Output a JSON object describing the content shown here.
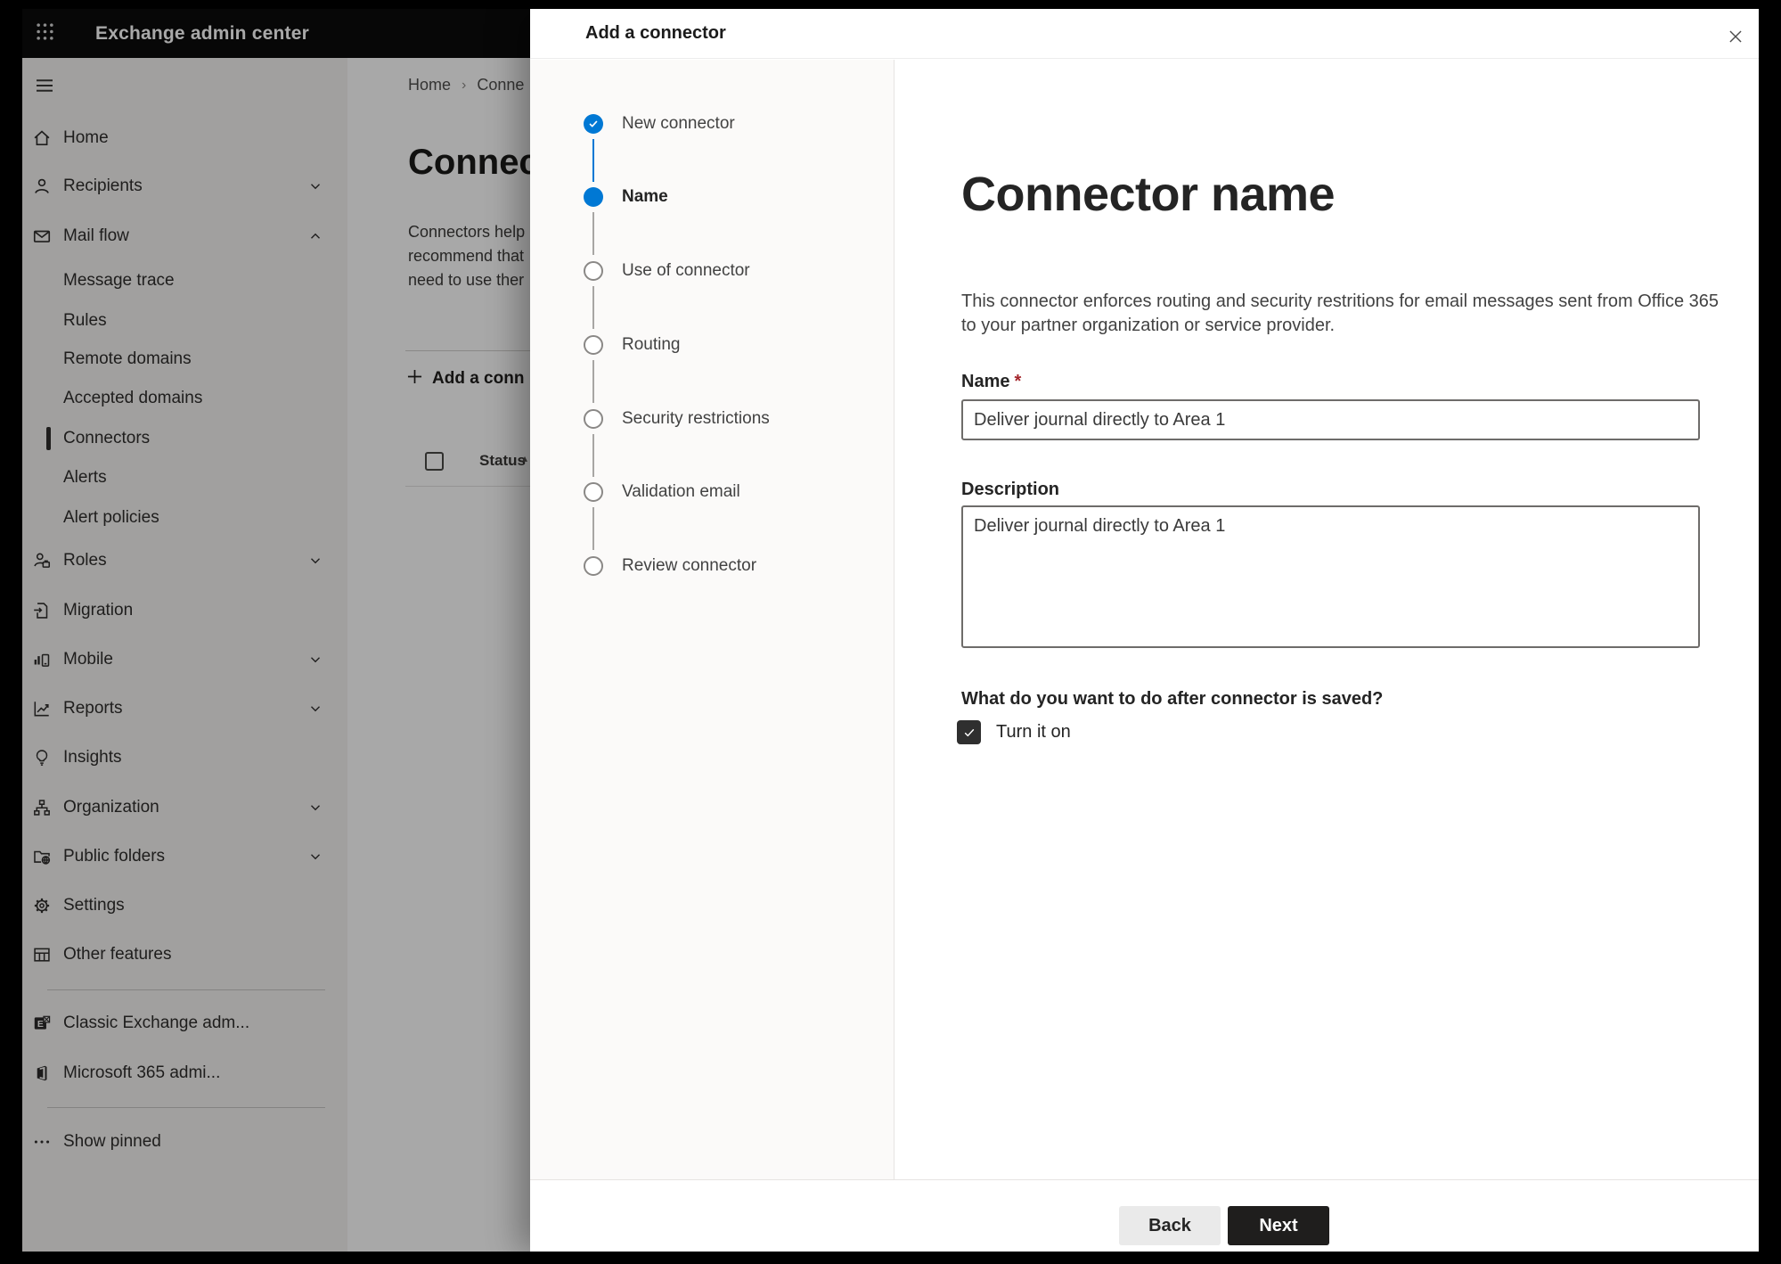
{
  "topbar": {
    "title": "Exchange admin center"
  },
  "sidebar": {
    "items": [
      {
        "label": "Home",
        "icon": "home-icon"
      },
      {
        "label": "Recipients",
        "icon": "person-icon",
        "chevron": "down"
      },
      {
        "label": "Mail flow",
        "icon": "mail-icon",
        "chevron": "up",
        "expanded": true
      },
      {
        "label": "Message trace",
        "indent": true
      },
      {
        "label": "Rules",
        "indent": true
      },
      {
        "label": "Remote domains",
        "indent": true
      },
      {
        "label": "Accepted domains",
        "indent": true
      },
      {
        "label": "Connectors",
        "indent": true,
        "selected": true
      },
      {
        "label": "Alerts",
        "indent": true
      },
      {
        "label": "Alert policies",
        "indent": true
      },
      {
        "label": "Roles",
        "icon": "roles-icon",
        "chevron": "down"
      },
      {
        "label": "Migration",
        "icon": "migration-icon"
      },
      {
        "label": "Mobile",
        "icon": "mobile-icon",
        "chevron": "down"
      },
      {
        "label": "Reports",
        "icon": "reports-icon",
        "chevron": "down"
      },
      {
        "label": "Insights",
        "icon": "lightbulb-icon"
      },
      {
        "label": "Organization",
        "icon": "org-chart-icon",
        "chevron": "down"
      },
      {
        "label": "Public folders",
        "icon": "folder-globe-icon",
        "chevron": "down"
      },
      {
        "label": "Settings",
        "icon": "gear-icon"
      },
      {
        "label": "Other features",
        "icon": "table-icon"
      },
      {
        "label": "Classic Exchange adm...",
        "icon": "exchange-logo-icon"
      },
      {
        "label": "Microsoft 365 admi...",
        "icon": "office-logo-icon"
      },
      {
        "label": "Show pinned",
        "icon": "ellipsis-icon"
      }
    ]
  },
  "page": {
    "breadcrumb": {
      "items": [
        "Home",
        "Conne"
      ],
      "separator": "›"
    },
    "title": "Connec",
    "intro_lines": [
      "Connectors help",
      "recommend that",
      "need to use ther"
    ],
    "add_button_label": "Add a conn",
    "table": {
      "status_header": "Status"
    }
  },
  "dialog": {
    "title": "Add a connector",
    "steps": [
      {
        "label": "New connector",
        "state": "completed"
      },
      {
        "label": "Name",
        "state": "active"
      },
      {
        "label": "Use of connector",
        "state": "upcoming"
      },
      {
        "label": "Routing",
        "state": "upcoming"
      },
      {
        "label": "Security restrictions",
        "state": "upcoming"
      },
      {
        "label": "Validation email",
        "state": "upcoming"
      },
      {
        "label": "Review connector",
        "state": "upcoming"
      }
    ],
    "content": {
      "heading": "Connector name",
      "intro_lines": [
        "This connector enforces routing and security restritions for email messages sent from Office 365",
        "to your partner organization or service provider."
      ],
      "name_label": "Name",
      "required_marker": "*",
      "name_value": "Deliver journal directly to Area 1",
      "description_label": "Description",
      "description_value": "Deliver journal directly to Area 1",
      "after_save_question": "What do you want to do after connector is saved?",
      "turn_on": {
        "label": "Turn it on",
        "checked": true
      }
    },
    "footer": {
      "back_label": "Back",
      "next_label": "Next"
    }
  },
  "colors": {
    "accent": "#0078d4",
    "required_asterisk": "#a4262c",
    "primary_button_bg": "#1f1e1d",
    "topbar_bg": "#0c0c0c"
  }
}
